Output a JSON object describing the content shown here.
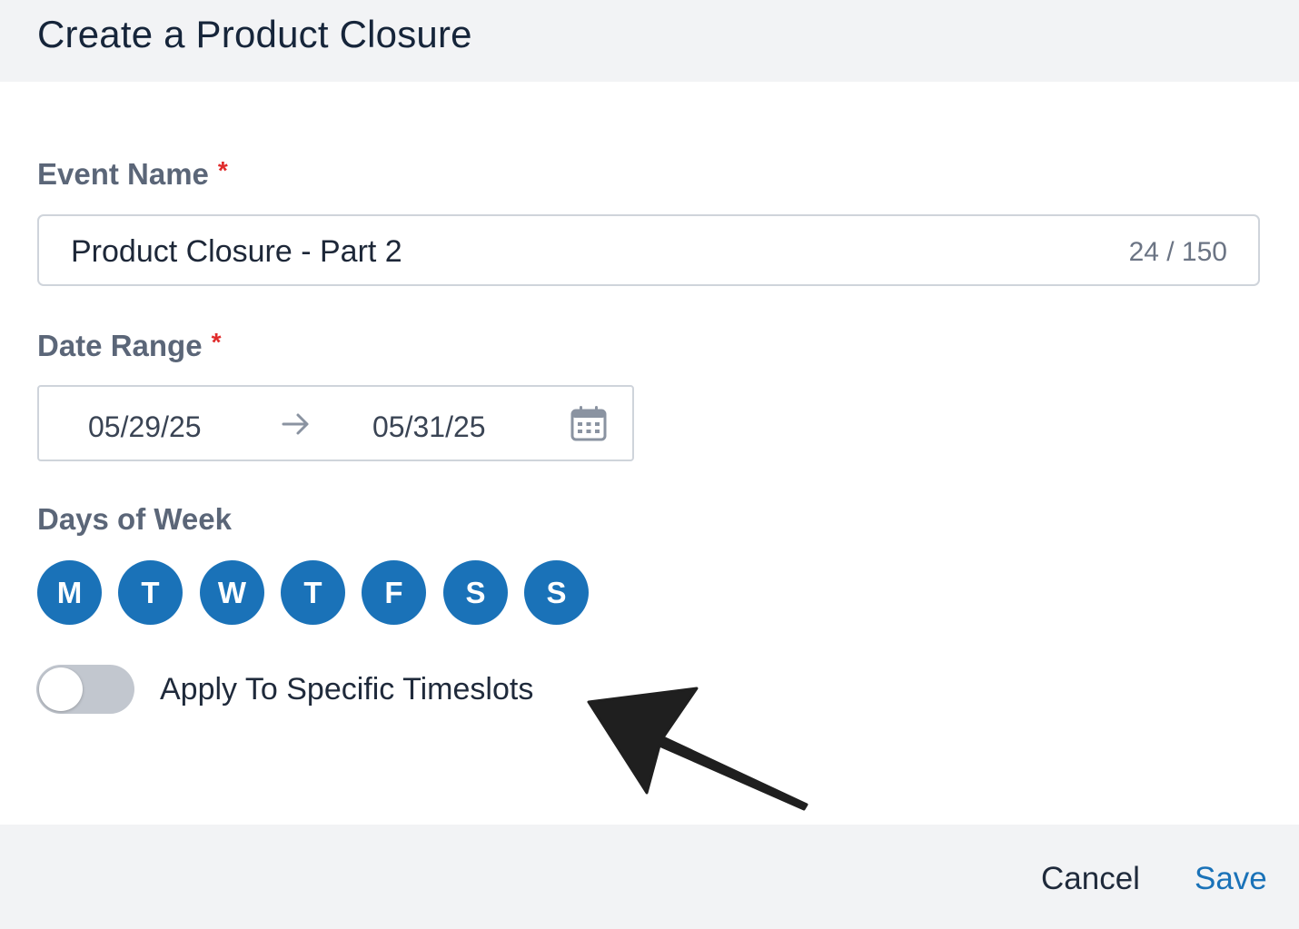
{
  "dialog": {
    "title": "Create a Product Closure"
  },
  "event_name": {
    "label": "Event Name",
    "required_mark": "*",
    "value": "Product Closure - Part 2",
    "counter": "24 / 150"
  },
  "date_range": {
    "label": "Date Range",
    "required_mark": "*",
    "start": "05/29/25",
    "end": "05/31/25",
    "separator_icon": "arrow-right-icon",
    "picker_icon": "calendar-icon"
  },
  "days_of_week": {
    "label": "Days of Week",
    "days": [
      "M",
      "T",
      "W",
      "T",
      "F",
      "S",
      "S"
    ],
    "selected": [
      true,
      true,
      true,
      true,
      true,
      true,
      true
    ]
  },
  "timeslots_toggle": {
    "label": "Apply To Specific Timeslots",
    "checked": false
  },
  "footer": {
    "cancel_label": "Cancel",
    "save_label": "Save"
  },
  "colors": {
    "accent": "#1a72b8",
    "required": "#e02b2b",
    "toggle_off": "#c2c7cf",
    "header_bg": "#f2f3f5"
  }
}
